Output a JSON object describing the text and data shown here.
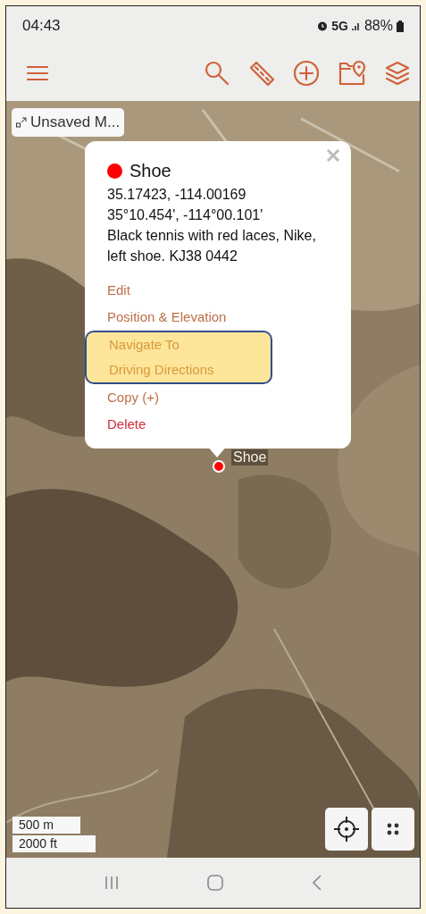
{
  "status_bar": {
    "time": "04:43",
    "network": "5G",
    "battery": "88%"
  },
  "map": {
    "title_chip": "Unsaved M...",
    "marker_label": "Shoe",
    "scale": [
      "500 m",
      "2000 ft"
    ]
  },
  "popup": {
    "name": "Shoe",
    "color": "#ff0000",
    "lines": [
      "35.17423, -114.00169",
      "35°10.454', -114°00.101'",
      "Black tennis with red laces, Nike, left shoe. KJ38 0442"
    ],
    "actions": [
      {
        "label": "Edit",
        "kind": "action",
        "highlighted": false
      },
      {
        "label": "Position & Elevation",
        "kind": "action",
        "highlighted": false
      },
      {
        "label": "Navigate To",
        "kind": "action",
        "highlighted": true
      },
      {
        "label": "Driving Directions",
        "kind": "action",
        "highlighted": true
      },
      {
        "label": "Copy (+)",
        "kind": "action",
        "highlighted": false
      },
      {
        "label": "Delete",
        "kind": "danger",
        "highlighted": false
      }
    ]
  }
}
